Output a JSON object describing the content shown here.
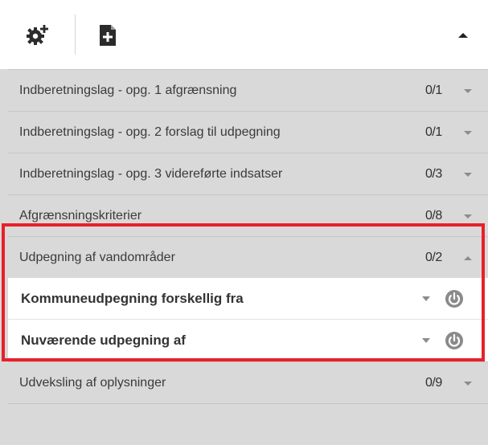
{
  "toolbar": {
    "icons": [
      "gear-add-icon",
      "add-document-icon",
      "collapse-up-icon"
    ]
  },
  "layers": [
    {
      "label": "Indberetningslag - opg. 1 afgrænsning",
      "count": "0/1",
      "expanded": false
    },
    {
      "label": "Indberetningslag - opg. 2 forslag til udpegning",
      "count": "0/1",
      "expanded": false
    },
    {
      "label": "Indberetningslag - opg. 3 videreførte indsatser",
      "count": "0/3",
      "expanded": false
    },
    {
      "label": "Afgrænsningskriterier",
      "count": "0/8",
      "expanded": false
    },
    {
      "label": "Udpegning af vandområder",
      "count": "0/2",
      "expanded": true
    },
    {
      "label": "Udveksling af oplysninger",
      "count": "0/9",
      "expanded": false
    }
  ],
  "sublayers": [
    {
      "label": "Kommuneudpegning forskellig fra"
    },
    {
      "label": "Nuværende udpegning af"
    }
  ],
  "colors": {
    "highlight": "#e8202a",
    "rowBg": "#d9d9d9",
    "subBg": "#ffffff",
    "power": "#8a8a8a"
  }
}
